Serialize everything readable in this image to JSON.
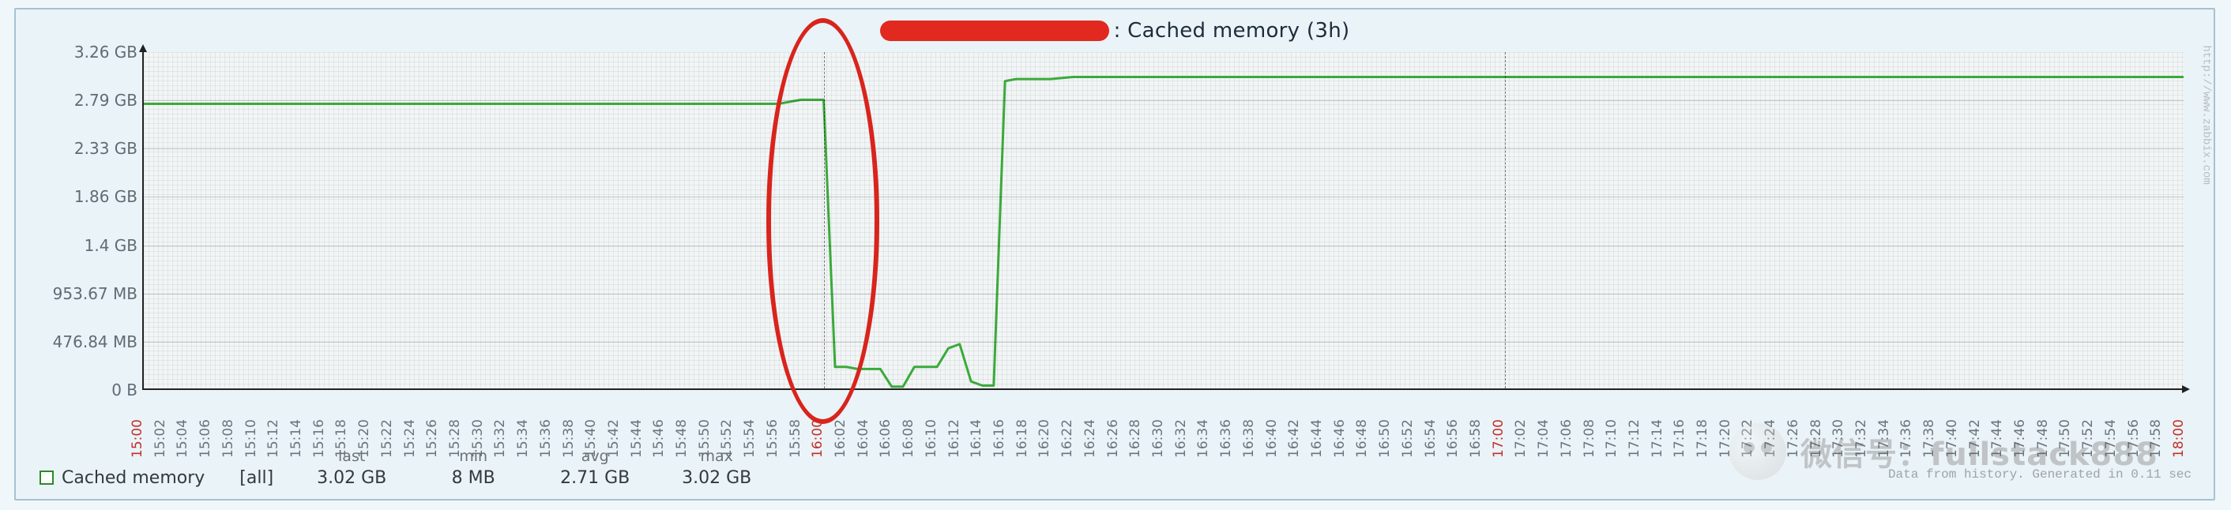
{
  "title_suffix": ": Cached memory  (3h)",
  "yaxis": {
    "ticks": [
      "0 B",
      "476.84 MB",
      "953.67 MB",
      "1.4 GB",
      "1.86 GB",
      "2.33 GB",
      "2.79 GB",
      "3.26 GB"
    ],
    "max_gb": 3.26
  },
  "xaxis": {
    "start": "15:00",
    "end": "18:00",
    "step_min": 2,
    "hour_marks": [
      "15:00",
      "16:00",
      "17:00",
      "18:00"
    ]
  },
  "legend": {
    "name": "Cached memory",
    "scope": "[all]",
    "stats": {
      "last": "3.02 GB",
      "min": "8 MB",
      "avg": "2.71 GB",
      "max": "3.02 GB"
    }
  },
  "footer": "Data from history. Generated in 0.11 sec",
  "side": "http://www.zabbix.com",
  "watermark_text": "微信号：fullstack888",
  "highlight": {
    "center_min": 60,
    "rx_min": 5,
    "ry_frac": 0.6
  },
  "chart_data": {
    "type": "line",
    "title": "Cached memory (3h)",
    "xlabel": "",
    "ylabel": "",
    "ylim_gb": [
      0,
      3.26
    ],
    "x_unit": "minutes after 15:00",
    "series": [
      {
        "name": "Cached memory",
        "color": "#3aaa3a",
        "points": [
          [
            0,
            2.76
          ],
          [
            2,
            2.76
          ],
          [
            4,
            2.76
          ],
          [
            6,
            2.76
          ],
          [
            8,
            2.76
          ],
          [
            10,
            2.76
          ],
          [
            12,
            2.76
          ],
          [
            14,
            2.76
          ],
          [
            16,
            2.76
          ],
          [
            18,
            2.76
          ],
          [
            20,
            2.76
          ],
          [
            22,
            2.76
          ],
          [
            24,
            2.76
          ],
          [
            26,
            2.76
          ],
          [
            28,
            2.76
          ],
          [
            30,
            2.76
          ],
          [
            32,
            2.76
          ],
          [
            34,
            2.76
          ],
          [
            36,
            2.76
          ],
          [
            38,
            2.76
          ],
          [
            40,
            2.76
          ],
          [
            42,
            2.76
          ],
          [
            44,
            2.76
          ],
          [
            46,
            2.76
          ],
          [
            48,
            2.76
          ],
          [
            50,
            2.76
          ],
          [
            52,
            2.76
          ],
          [
            54,
            2.76
          ],
          [
            56,
            2.76
          ],
          [
            58,
            2.8
          ],
          [
            60,
            2.8
          ],
          [
            61,
            0.22
          ],
          [
            62,
            0.22
          ],
          [
            63,
            0.2
          ],
          [
            64,
            0.2
          ],
          [
            65,
            0.2
          ],
          [
            66,
            0.03
          ],
          [
            67,
            0.03
          ],
          [
            68,
            0.22
          ],
          [
            69,
            0.22
          ],
          [
            70,
            0.22
          ],
          [
            71,
            0.4
          ],
          [
            72,
            0.44
          ],
          [
            73,
            0.08
          ],
          [
            74,
            0.04
          ],
          [
            75,
            0.04
          ],
          [
            76,
            2.98
          ],
          [
            77,
            3.0
          ],
          [
            78,
            3.0
          ],
          [
            80,
            3.0
          ],
          [
            82,
            3.02
          ],
          [
            84,
            3.02
          ],
          [
            86,
            3.02
          ],
          [
            88,
            3.02
          ],
          [
            90,
            3.02
          ],
          [
            92,
            3.02
          ],
          [
            94,
            3.02
          ],
          [
            96,
            3.02
          ],
          [
            98,
            3.02
          ],
          [
            100,
            3.02
          ],
          [
            102,
            3.02
          ],
          [
            104,
            3.02
          ],
          [
            106,
            3.02
          ],
          [
            108,
            3.02
          ],
          [
            110,
            3.02
          ],
          [
            112,
            3.02
          ],
          [
            114,
            3.02
          ],
          [
            116,
            3.02
          ],
          [
            118,
            3.02
          ],
          [
            120,
            3.02
          ],
          [
            122,
            3.02
          ],
          [
            124,
            3.02
          ],
          [
            126,
            3.02
          ],
          [
            128,
            3.02
          ],
          [
            130,
            3.02
          ],
          [
            132,
            3.02
          ],
          [
            134,
            3.02
          ],
          [
            136,
            3.02
          ],
          [
            138,
            3.02
          ],
          [
            140,
            3.02
          ],
          [
            142,
            3.02
          ],
          [
            144,
            3.02
          ],
          [
            146,
            3.02
          ],
          [
            148,
            3.02
          ],
          [
            150,
            3.02
          ],
          [
            152,
            3.02
          ],
          [
            154,
            3.02
          ],
          [
            156,
            3.02
          ],
          [
            158,
            3.02
          ],
          [
            160,
            3.02
          ],
          [
            162,
            3.02
          ],
          [
            164,
            3.02
          ],
          [
            166,
            3.02
          ],
          [
            168,
            3.02
          ],
          [
            170,
            3.02
          ],
          [
            172,
            3.02
          ],
          [
            174,
            3.02
          ],
          [
            176,
            3.02
          ],
          [
            178,
            3.02
          ],
          [
            180,
            3.02
          ]
        ]
      }
    ]
  }
}
